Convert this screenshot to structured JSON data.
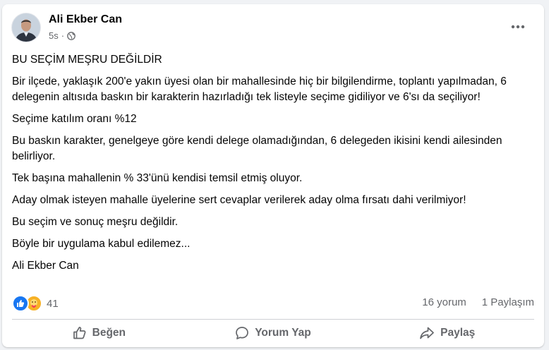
{
  "post": {
    "author_name": "Ali Ekber Can",
    "time": "5s",
    "separator": "·",
    "privacy_icon": "globe-icon",
    "more_icon": "more-options-icon",
    "paragraphs": [
      "BU SEÇİM MEŞRU DEĞİLDİR",
      "Bir ilçede, yaklaşık 200'e yakın üyesi olan bir mahallesinde hiç bir bilgilendirme, toplantı yapılmadan, 6 delegenin altısıda baskın bir karakterin hazırladığı tek listeyle seçime gidiliyor ve 6'sı da seçiliyor!",
      "Seçime katılım oranı %12",
      "Bu baskın karakter, genelgeye göre kendi delege olamadığından, 6 delegeden ikisini kendi ailesinden belirliyor.",
      "Tek başına mahallenin % 33'ünü kendisi temsil etmiş oluyor.",
      "Aday olmak isteyen mahalle üyelerine sert cevaplar verilerek aday olma fırsatı dahi verilmiyor!",
      "Bu seçim ve sonuç meşru değildir.",
      "Böyle bir uygulama kabul edilemez...",
      "Ali Ekber Can"
    ]
  },
  "stats": {
    "reaction_icons": [
      "like-reaction-icon",
      "care-reaction-icon"
    ],
    "reaction_count": "41",
    "comments": "16 yorum",
    "shares": "1 Paylaşım"
  },
  "actions": {
    "like": "Beğen",
    "comment": "Yorum Yap",
    "share": "Paylaş"
  },
  "colors": {
    "accent": "#1877f2",
    "care": "#f7b125",
    "secondary_text": "#65676b",
    "divider": "#ced0d4"
  }
}
